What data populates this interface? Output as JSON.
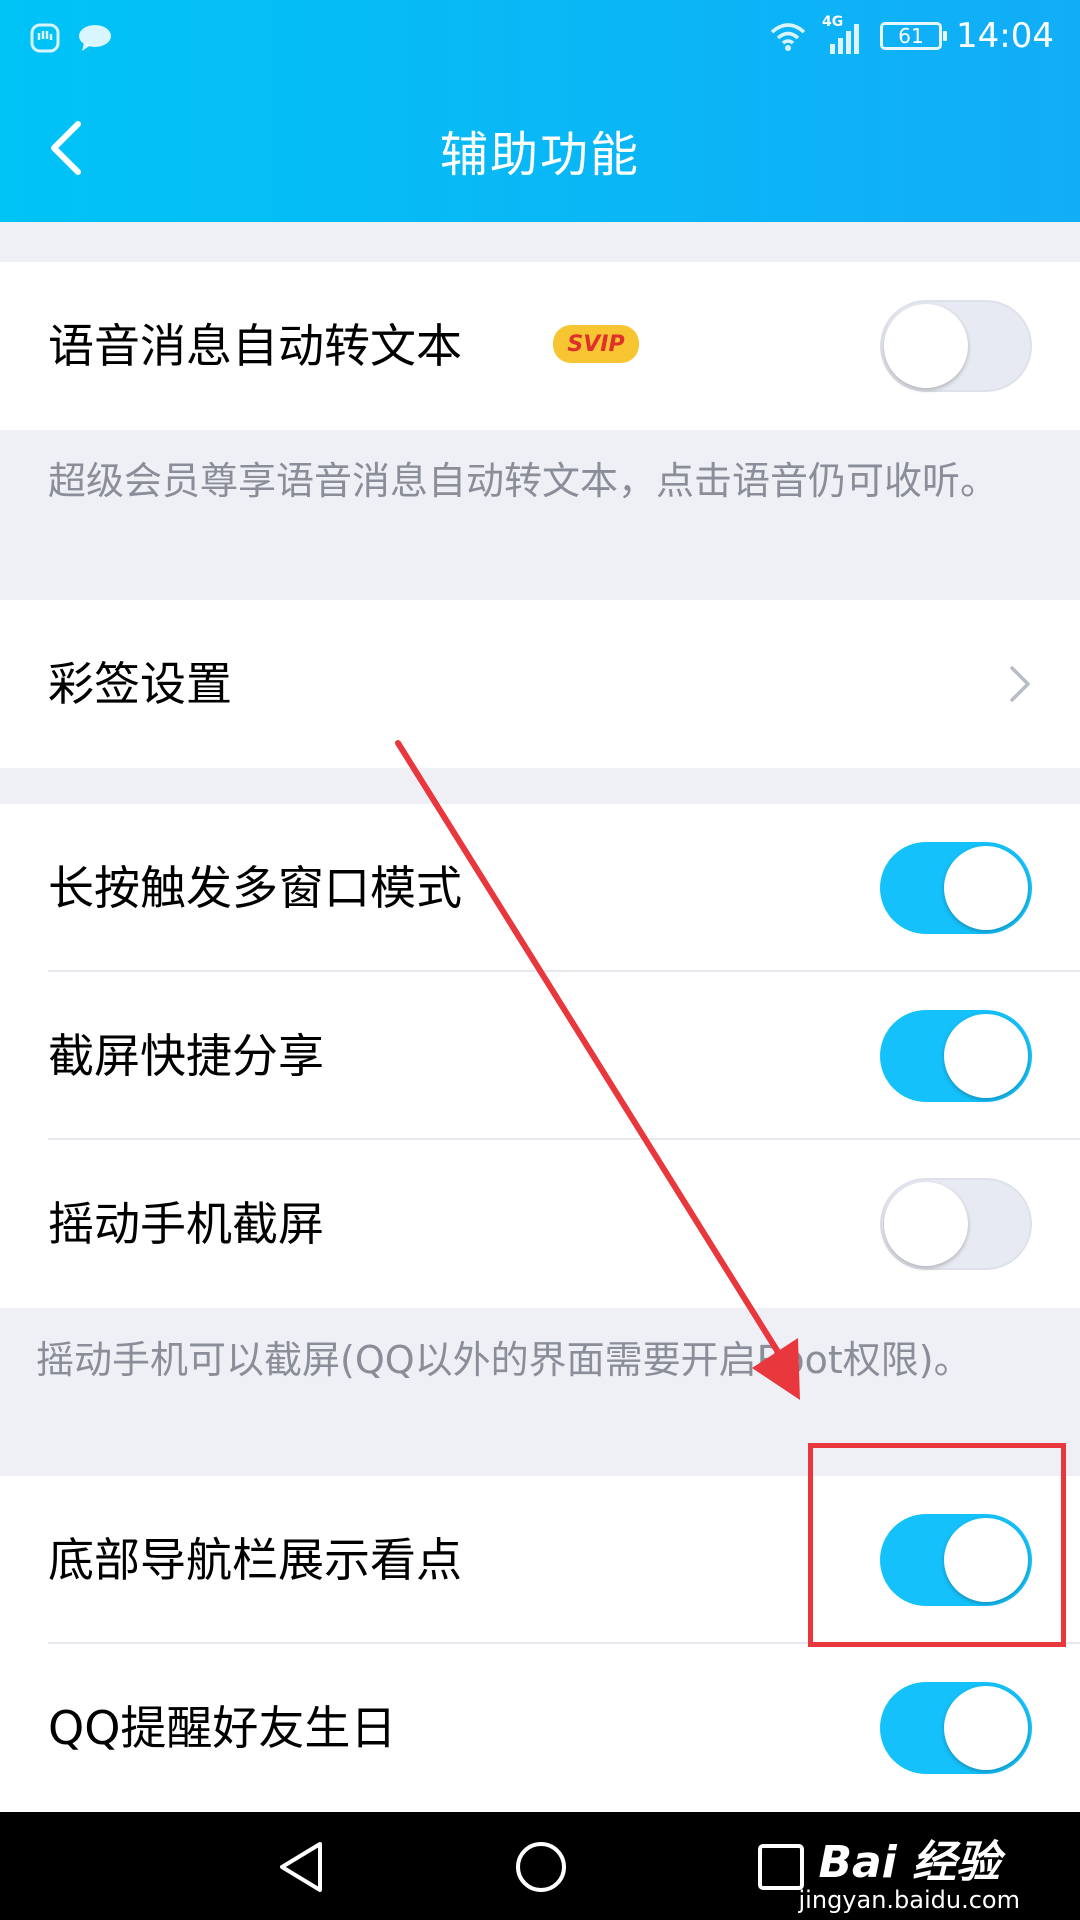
{
  "status_bar": {
    "time": "14:04",
    "battery": "61",
    "network": "4G",
    "left_icons": [
      "notification-icon",
      "chat-bubble-icon"
    ],
    "right_icons": [
      "wifi-icon",
      "signal-icon",
      "battery-icon"
    ]
  },
  "header": {
    "title": "辅助功能",
    "back_icon": "chevron-left-icon"
  },
  "settings": {
    "voice_to_text": {
      "label": "语音消息自动转文本",
      "badge": "SVIP",
      "enabled": false
    },
    "voice_desc": "超级会员尊享语音消息自动转文本，点击语音仍可收听。",
    "color_sign": {
      "label": "彩签设置"
    },
    "long_press_multi_window": {
      "label": "长按触发多窗口模式",
      "enabled": true
    },
    "screenshot_share": {
      "label": "截屏快捷分享",
      "enabled": true
    },
    "shake_screenshot": {
      "label": "摇动手机截屏",
      "enabled": false
    },
    "shake_desc": "摇动手机可以截屏(QQ以外的界面需要开启Root权限)。",
    "bottom_nav_kandian": {
      "label": "底部导航栏展示看点",
      "enabled": true
    },
    "birthday_reminder": {
      "label": "QQ提醒好友生日",
      "enabled": true
    }
  },
  "nav_bar": {
    "icons": [
      "back-triangle-icon",
      "home-circle-icon",
      "recents-square-icon"
    ]
  },
  "watermark": {
    "logo": "Bai 经验",
    "sub": "jingyan.baidu.com"
  },
  "colors": {
    "header_start": "#00c3f6",
    "header_end": "#12adf7",
    "toggle_on": "#15c1fb",
    "annotation_red": "#e8373d"
  }
}
